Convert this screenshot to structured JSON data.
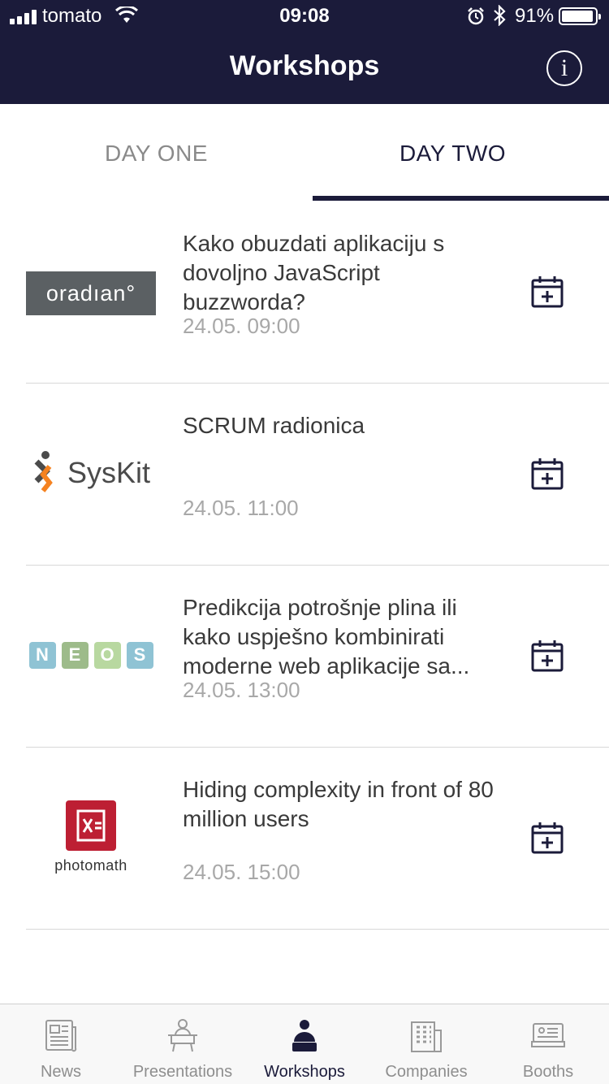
{
  "status": {
    "carrier": "tomato",
    "time": "09:08",
    "battery": "91%"
  },
  "header": {
    "title": "Workshops",
    "info_label": "i"
  },
  "tabs": [
    {
      "label": "DAY ONE"
    },
    {
      "label": "DAY TWO"
    }
  ],
  "workshops": [
    {
      "logo": "oradian",
      "logo_text": "oradıan°",
      "title": "Kako obuzdati aplikaciju s dovoljno JavaScript buzzworda?",
      "time": "24.05. 09:00"
    },
    {
      "logo": "syskit",
      "logo_text": "SysKit",
      "title": "SCRUM radionica",
      "time": "24.05. 11:00"
    },
    {
      "logo": "neos",
      "logo_letters": [
        "N",
        "E",
        "O",
        "S"
      ],
      "title": "Predikcija potrošnje plina ili kako uspješno kombinirati moderne web aplikacije sa...",
      "time": "24.05. 13:00"
    },
    {
      "logo": "photomath",
      "logo_text": "photomath",
      "title": "Hiding complexity in front of 80 million users",
      "time": "24.05. 15:00"
    }
  ],
  "tabbar": [
    {
      "label": "News",
      "icon": "newspaper-icon"
    },
    {
      "label": "Presentations",
      "icon": "presenter-icon"
    },
    {
      "label": "Workshops",
      "icon": "person-desk-icon"
    },
    {
      "label": "Companies",
      "icon": "building-icon"
    },
    {
      "label": "Booths",
      "icon": "booth-icon"
    }
  ],
  "colors": {
    "nav": "#1b1b3a",
    "oradian": "#5b6063",
    "photomath": "#bd1f33",
    "syskit_orange": "#f58220"
  }
}
